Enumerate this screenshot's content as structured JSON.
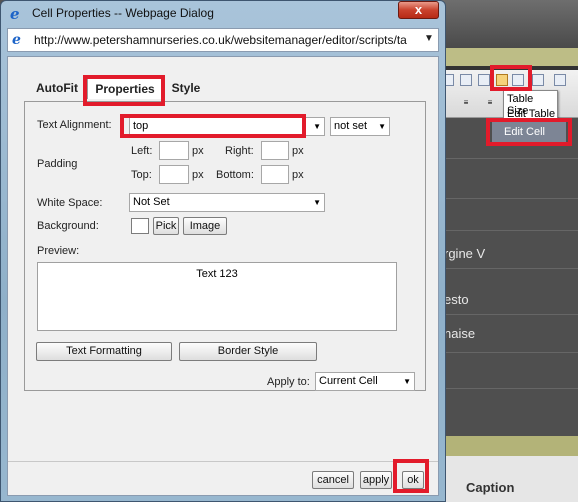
{
  "dialog": {
    "title": "Cell Properties -- Webpage Dialog",
    "close_glyph": "x",
    "address": "http://www.petershamnurseries.co.uk/websitemanager/editor/scripts/ta",
    "tabs": [
      "AutoFit",
      "Properties",
      "Style"
    ],
    "active_tab": "Properties",
    "text_alignment": {
      "label": "Text Alignment:",
      "value": "top",
      "second_value": "not set"
    },
    "padding": {
      "label": "Padding",
      "left_label": "Left:",
      "right_label": "Right:",
      "top_label": "Top:",
      "bottom_label": "Bottom:",
      "unit": "px",
      "left": "",
      "right": "",
      "top": "",
      "bottom": ""
    },
    "white_space": {
      "label": "White Space:",
      "value": "Not Set"
    },
    "background": {
      "label": "Background:",
      "pick_label": "Pick",
      "image_label": "Image"
    },
    "preview": {
      "label": "Preview:",
      "text": "Text 123"
    },
    "text_formatting_label": "Text Formatting",
    "border_style_label": "Border Style",
    "apply_to": {
      "label": "Apply to:",
      "value": "Current Cell"
    },
    "buttons": {
      "cancel": "cancel",
      "apply": "apply",
      "ok": "ok"
    }
  },
  "background_editor": {
    "menu": [
      "Table Size",
      "Edit Table",
      "Edit Cell"
    ],
    "highlighted_item": "Edit Cell",
    "content_texts": [
      "rgine V",
      "esto",
      "naise"
    ],
    "caption": "Caption"
  },
  "colors": {
    "highlight_box": "#e21b2b",
    "olive": "#bdbd86",
    "close": "#c9422d"
  },
  "icons": [
    "ie-page-icon",
    "close-icon",
    "dropdown-arrow-icon",
    "table-edit-icon"
  ]
}
